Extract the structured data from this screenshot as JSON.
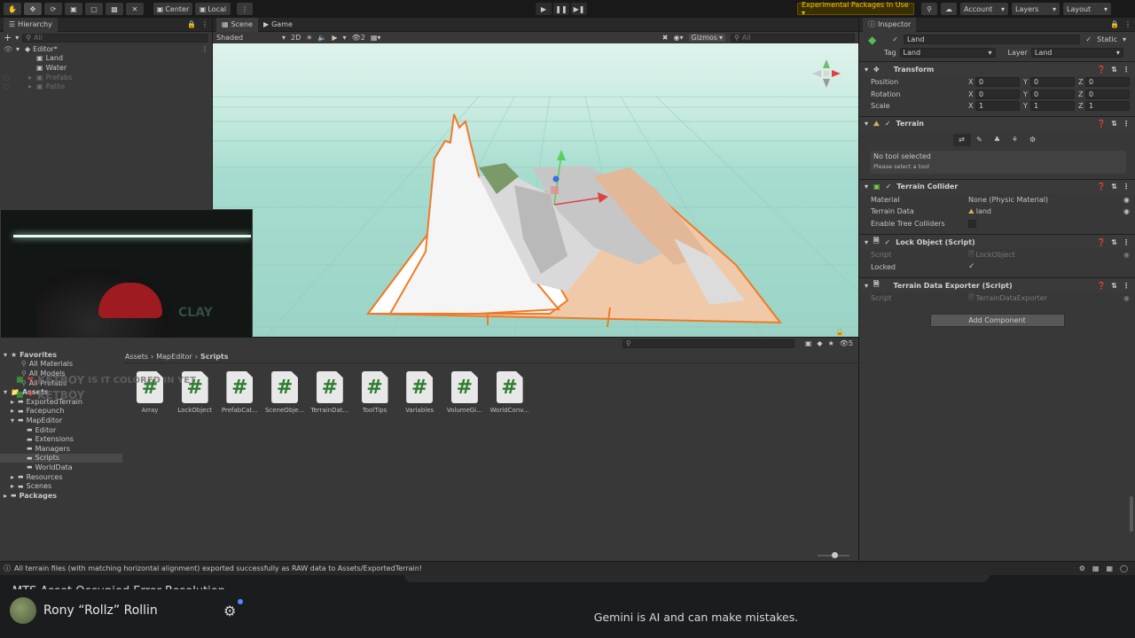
{
  "toolbar": {
    "pivot_label": "Center",
    "space_label": "Local",
    "experimental_label": "Experimental Packages In Use ▾",
    "account_label": "Account",
    "layers_label": "Layers",
    "layout_label": "Layout"
  },
  "hierarchy": {
    "tab_label": "Hierarchy",
    "search_placeholder": "All",
    "scene_name": "Editor*",
    "items": [
      {
        "label": "Land",
        "muted": false
      },
      {
        "label": "Water",
        "muted": false
      },
      {
        "label": "Prefabs",
        "muted": true
      },
      {
        "label": "Paths",
        "muted": true
      }
    ]
  },
  "scene_view": {
    "tabs": [
      "Scene",
      "Game"
    ],
    "shading_mode": "Shaded",
    "mode_2d": "2D",
    "gizmos_label": "Gizmos",
    "search_placeholder": "All",
    "fx_count": "2"
  },
  "webcam": {
    "overlay_text": "CLAY"
  },
  "chat_overlay": [
    {
      "user": "KETBOY",
      "message": "IS IT COLORED IN YET"
    },
    {
      "user": "KETBOY",
      "message": ""
    }
  ],
  "project": {
    "search_placeholder": "",
    "visible_count": "5",
    "breadcrumb": [
      "Assets",
      "MapEditor",
      "Scripts"
    ],
    "favorites_label": "Favorites",
    "favorites": [
      "All Materials",
      "All Models",
      "All Prefabs"
    ],
    "assets_label": "Assets",
    "tree": [
      {
        "label": "ExportedTerrain",
        "indent": 1
      },
      {
        "label": "Facepunch",
        "indent": 1
      },
      {
        "label": "MapEditor",
        "indent": 1
      },
      {
        "label": "Editor",
        "indent": 2
      },
      {
        "label": "Extensions",
        "indent": 2
      },
      {
        "label": "Managers",
        "indent": 2
      },
      {
        "label": "Scripts",
        "indent": 2
      },
      {
        "label": "WorldData",
        "indent": 2
      },
      {
        "label": "Resources",
        "indent": 1
      },
      {
        "label": "Scenes",
        "indent": 1
      },
      {
        "label": "Packages",
        "indent": 0
      }
    ],
    "assets": [
      "Array",
      "LockObject",
      "PrefabCat...",
      "SceneObje...",
      "TerrainDat...",
      "ToolTips",
      "Variables",
      "VolumeGi...",
      "WorldConv..."
    ]
  },
  "inspector": {
    "tab_label": "Inspector",
    "object_name": "Land",
    "static_label": "Static",
    "tag_label": "Tag",
    "tag_value": "Land",
    "layer_label": "Layer",
    "layer_value": "Land",
    "transform": {
      "title": "Transform",
      "position_label": "Position",
      "rotation_label": "Rotation",
      "scale_label": "Scale",
      "position": [
        "0",
        "0",
        "0"
      ],
      "rotation": [
        "0",
        "0",
        "0"
      ],
      "scale": [
        "1",
        "1",
        "1"
      ]
    },
    "terrain": {
      "title": "Terrain",
      "no_tool": "No tool selected",
      "hint": "Please select a tool"
    },
    "terrain_collider": {
      "title": "Terrain Collider",
      "material_label": "Material",
      "material_value": "None (Physic Material)",
      "data_label": "Terrain Data",
      "data_value": "land",
      "trees_label": "Enable Tree Colliders"
    },
    "lock_object": {
      "title": "Lock Object (Script)",
      "script_label": "Script",
      "script_value": "LockObject",
      "locked_label": "Locked"
    },
    "exporter": {
      "title": "Terrain Data Exporter (Script)",
      "script_label": "Script",
      "script_value": "TerrainDataExporter"
    },
    "add_component": "Add Component"
  },
  "status_bar": {
    "message": "All terrain files (with matching horizontal alignment) exported successfully as RAW data to Assets/ExportedTerrain!"
  },
  "bottom_overlay": {
    "cut_title": "MTS Asset Occupied Error Resolution",
    "user_name": "Rony “Rollz” Rollin",
    "disclaimer": "Gemini is AI and can make mistakes."
  },
  "colors": {
    "accent_selection": "#e8833a",
    "experimental_bg": "#4a3a00",
    "script_hash": "#2f7d2f",
    "sky_top": "#d0ebe3",
    "ground": "#9ed3c8"
  }
}
